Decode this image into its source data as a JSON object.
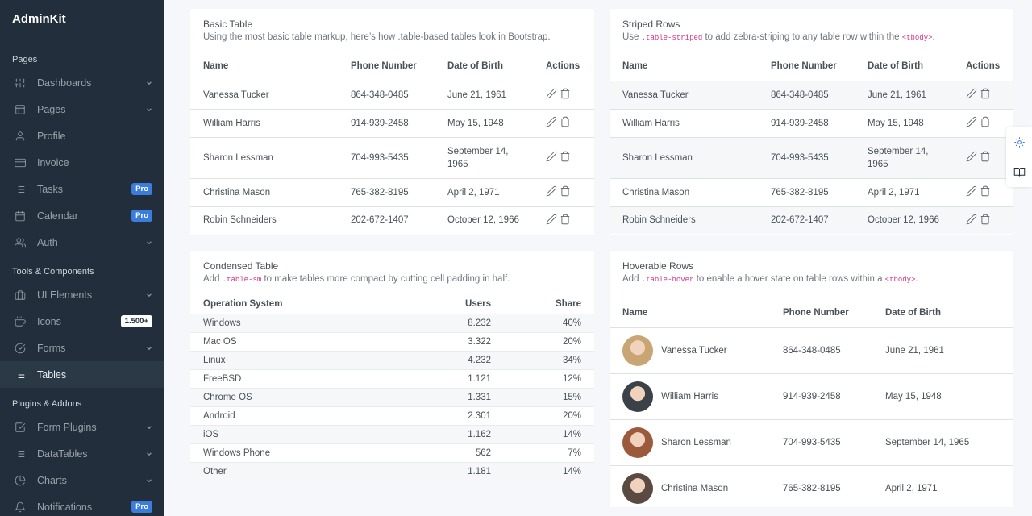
{
  "brand": "AdminKit",
  "sidebar": {
    "sections": [
      {
        "header": "Pages",
        "items": [
          {
            "label": "Dashboards",
            "icon": "sliders-icon",
            "chevron": true
          },
          {
            "label": "Pages",
            "icon": "layout-icon",
            "chevron": true
          },
          {
            "label": "Profile",
            "icon": "user-icon"
          },
          {
            "label": "Invoice",
            "icon": "credit-card-icon"
          },
          {
            "label": "Tasks",
            "icon": "list-icon",
            "badge": "Pro"
          },
          {
            "label": "Calendar",
            "icon": "calendar-icon",
            "badge": "Pro"
          },
          {
            "label": "Auth",
            "icon": "users-icon",
            "chevron": true
          }
        ]
      },
      {
        "header": "Tools & Components",
        "items": [
          {
            "label": "UI Elements",
            "icon": "briefcase-icon",
            "chevron": true
          },
          {
            "label": "Icons",
            "icon": "coffee-icon",
            "badge": "1.500+"
          },
          {
            "label": "Forms",
            "icon": "check-circle-icon",
            "chevron": true
          },
          {
            "label": "Tables",
            "icon": "list-icon",
            "active": true
          }
        ]
      },
      {
        "header": "Plugins & Addons",
        "items": [
          {
            "label": "Form Plugins",
            "icon": "check-square-icon",
            "chevron": true
          },
          {
            "label": "DataTables",
            "icon": "list-icon",
            "chevron": true
          },
          {
            "label": "Charts",
            "icon": "pie-chart-icon",
            "chevron": true
          },
          {
            "label": "Notifications",
            "icon": "bell-icon",
            "badge": "Pro"
          }
        ]
      }
    ]
  },
  "basic": {
    "title": "Basic Table",
    "subtitle": "Using the most basic table markup, here’s how .table-based tables look in Bootstrap.",
    "headers": [
      "Name",
      "Phone Number",
      "Date of Birth",
      "Actions"
    ],
    "rows": [
      [
        "Vanessa Tucker",
        "864-348-0485",
        "June 21, 1961"
      ],
      [
        "William Harris",
        "914-939-2458",
        "May 15, 1948"
      ],
      [
        "Sharon Lessman",
        "704-993-5435",
        "September 14, 1965"
      ],
      [
        "Christina Mason",
        "765-382-8195",
        "April 2, 1971"
      ],
      [
        "Robin Schneiders",
        "202-672-1407",
        "October 12, 1966"
      ]
    ]
  },
  "striped": {
    "title": "Striped Rows",
    "subtitle_pre": "Use",
    "code1": ".table-striped",
    "subtitle_mid": "to add zebra-striping to any table row within the",
    "code2": "<tbody>",
    "subtitle_post": ".",
    "headers": [
      "Name",
      "Phone Number",
      "Date of Birth",
      "Actions"
    ],
    "rows": [
      [
        "Vanessa Tucker",
        "864-348-0485",
        "June 21, 1961"
      ],
      [
        "William Harris",
        "914-939-2458",
        "May 15, 1948"
      ],
      [
        "Sharon Lessman",
        "704-993-5435",
        "September 14, 1965"
      ],
      [
        "Christina Mason",
        "765-382-8195",
        "April 2, 1971"
      ],
      [
        "Robin Schneiders",
        "202-672-1407",
        "October 12, 1966"
      ]
    ]
  },
  "condensed": {
    "title": "Condensed Table",
    "subtitle_pre": "Add",
    "code1": ".table-sm",
    "subtitle_post": "to make tables more compact by cutting cell padding in half.",
    "headers": [
      "Operation System",
      "Users",
      "Share"
    ],
    "rows": [
      [
        "Windows",
        "8.232",
        "40%"
      ],
      [
        "Mac OS",
        "3.322",
        "20%"
      ],
      [
        "Linux",
        "4.232",
        "34%"
      ],
      [
        "FreeBSD",
        "1.121",
        "12%"
      ],
      [
        "Chrome OS",
        "1.331",
        "15%"
      ],
      [
        "Android",
        "2.301",
        "20%"
      ],
      [
        "iOS",
        "1.162",
        "14%"
      ],
      [
        "Windows Phone",
        "562",
        "7%"
      ],
      [
        "Other",
        "1.181",
        "14%"
      ]
    ]
  },
  "hover": {
    "title": "Hoverable Rows",
    "subtitle_pre": "Add",
    "code1": ".table-hover",
    "subtitle_mid": "to enable a hover state on table rows within a",
    "code2": "<tbody>",
    "subtitle_post": ".",
    "headers": [
      "Name",
      "Phone Number",
      "Date of Birth"
    ],
    "rows": [
      [
        "Vanessa Tucker",
        "864-348-0485",
        "June 21, 1961"
      ],
      [
        "William Harris",
        "914-939-2458",
        "May 15, 1948"
      ],
      [
        "Sharon Lessman",
        "704-993-5435",
        "September 14, 1965"
      ],
      [
        "Christina Mason",
        "765-382-8195",
        "April 2, 1971"
      ]
    ],
    "avatar_colors": [
      "#c9a574",
      "#3a4148",
      "#9c5a3c",
      "#5a4a42"
    ]
  },
  "colors": {
    "sidebar": "#222e3c",
    "primary": "#3b7ddd",
    "background": "#f5f7fb"
  }
}
